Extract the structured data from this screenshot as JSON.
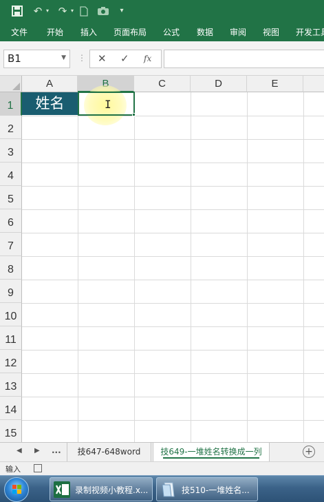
{
  "ribbon": {
    "tabs": [
      "文件",
      "开始",
      "插入",
      "页面布局",
      "公式",
      "数据",
      "审阅",
      "视图",
      "开发工具"
    ]
  },
  "formula_bar": {
    "name_box": "B1",
    "fx": "fx",
    "value": ""
  },
  "grid": {
    "columns": [
      "A",
      "B",
      "C",
      "D",
      "E"
    ],
    "rows": [
      "1",
      "2",
      "3",
      "4",
      "5",
      "6",
      "7",
      "8",
      "9",
      "10",
      "11",
      "12",
      "13",
      "14",
      "15"
    ],
    "cells": {
      "A1": "姓名",
      "B1": ""
    },
    "selected_cell": "B1",
    "header_fill": "#1a5d70"
  },
  "sheet_tabs": {
    "more": "...",
    "tabs": [
      "技647-648word",
      "技649-一堆姓名转换成一列"
    ],
    "active_index": 1
  },
  "status_bar": {
    "mode": "输入"
  },
  "taskbar": {
    "items": [
      "录制视频小教程.x...",
      "技510-一堆姓名..."
    ]
  },
  "colors": {
    "excel_green": "#217346"
  }
}
